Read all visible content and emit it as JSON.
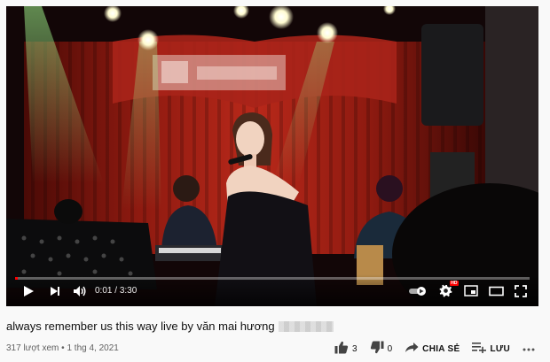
{
  "player": {
    "current_time": "0:01",
    "time_separator": " / ",
    "duration": "3:30",
    "progress": 0.005,
    "cc_badge": "HD",
    "accent_color": "#ff0000"
  },
  "video": {
    "title": "always remember us this way live by văn mai hương",
    "views": "317 lượt xem",
    "dot": " • ",
    "date": "1 thg 4, 2021"
  },
  "actions": {
    "like_count": "3",
    "dislike_count": "0",
    "share_label": "CHIA SẺ",
    "save_label": "LƯU"
  },
  "icons": {
    "play": "play-icon",
    "next": "next-icon",
    "volume": "volume-icon",
    "autoplay": "autoplay-toggle-icon",
    "settings": "gear-icon",
    "miniplayer": "miniplayer-icon",
    "theater": "theater-icon",
    "fullscreen": "fullscreen-icon",
    "like": "thumbs-up-icon",
    "dislike": "thumbs-down-icon",
    "share": "share-icon",
    "save": "playlist-add-icon",
    "more": "more-icon"
  }
}
